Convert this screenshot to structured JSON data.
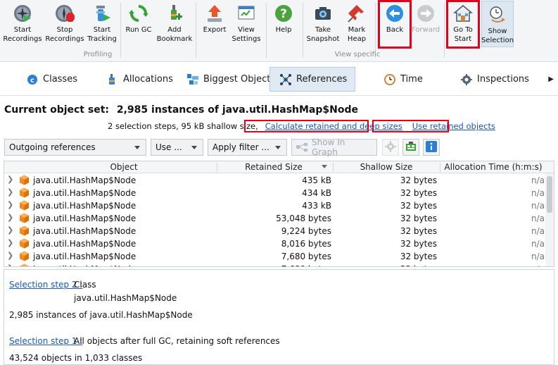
{
  "toolbar": {
    "buttons": [
      {
        "label": "Start\nRecordings"
      },
      {
        "label": "Stop\nRecordings"
      },
      {
        "label": "Start\nTracking"
      },
      {
        "label": "Run GC"
      },
      {
        "label": "Add\nBookmark"
      },
      {
        "label": "Export"
      },
      {
        "label": "View\nSettings"
      },
      {
        "label": "Help"
      },
      {
        "label": "Take\nSnapshot"
      },
      {
        "label": "Mark\nHeap"
      },
      {
        "label": "Back"
      },
      {
        "label": "Forward"
      },
      {
        "label": "Go To\nStart"
      },
      {
        "label": "Show\nSelection"
      }
    ],
    "group_profiling": "Profiling",
    "group_view_specific": "View specific"
  },
  "tabs": [
    {
      "label": "Classes"
    },
    {
      "label": "Allocations"
    },
    {
      "label": "Biggest Objects"
    },
    {
      "label": "References"
    },
    {
      "label": "Time"
    },
    {
      "label": "Inspections"
    }
  ],
  "header": {
    "title_prefix": "Current object set:",
    "title_value": "2,985 instances of java.util.HashMap$Node",
    "info": "2 selection steps, 95 kB shallow size,",
    "link_calculate": "Calculate retained and deep sizes",
    "link_use_retained": "Use retained objects"
  },
  "controls": {
    "reference_mode": "Outgoing references",
    "use_label": "Use ...",
    "apply_filter_label": "Apply filter ...",
    "show_in_graph_label": "Show In Graph"
  },
  "table": {
    "columns": [
      "Object",
      "Retained Size",
      "Shallow Size",
      "Allocation Time (h:m:s)"
    ],
    "rows": [
      {
        "object": "java.util.HashMap$Node",
        "retained": "435 kB",
        "shallow": "32 bytes",
        "alloc": "n/a"
      },
      {
        "object": "java.util.HashMap$Node",
        "retained": "434 kB",
        "shallow": "32 bytes",
        "alloc": "n/a"
      },
      {
        "object": "java.util.HashMap$Node",
        "retained": "433 kB",
        "shallow": "32 bytes",
        "alloc": "n/a"
      },
      {
        "object": "java.util.HashMap$Node",
        "retained": "53,048 bytes",
        "shallow": "32 bytes",
        "alloc": "n/a"
      },
      {
        "object": "java.util.HashMap$Node",
        "retained": "9,224 bytes",
        "shallow": "32 bytes",
        "alloc": "n/a"
      },
      {
        "object": "java.util.HashMap$Node",
        "retained": "8,016 bytes",
        "shallow": "32 bytes",
        "alloc": "n/a"
      },
      {
        "object": "java.util.HashMap$Node",
        "retained": "7,680 bytes",
        "shallow": "32 bytes",
        "alloc": "n/a"
      },
      {
        "object": "java.util.HashMap$Node",
        "retained": "7,680 bytes",
        "shallow": "32 bytes",
        "alloc": "n/a"
      }
    ]
  },
  "detail": {
    "step2_link": "Selection step 2 :",
    "step2_kind": "Class",
    "step2_class": "java.util.HashMap$Node",
    "step2_summary": "2,985 instances of java.util.HashMap$Node",
    "step1_link": "Selection step 1 :",
    "step1_desc": "All objects after full GC, retaining soft references",
    "step1_summary": "43,524 objects in 1,033 classes"
  },
  "colors": {
    "highlight_border": "#e3001b",
    "link": "#1a56b4",
    "object_icon": "#f08a1c"
  },
  "icons": [
    "start-recordings-icon",
    "stop-recordings-icon",
    "start-tracking-icon",
    "run-gc-icon",
    "add-bookmark-icon",
    "export-icon",
    "view-settings-icon",
    "help-icon",
    "take-snapshot-icon",
    "mark-heap-icon",
    "back-icon",
    "forward-icon",
    "go-to-start-icon",
    "show-selection-icon"
  ]
}
